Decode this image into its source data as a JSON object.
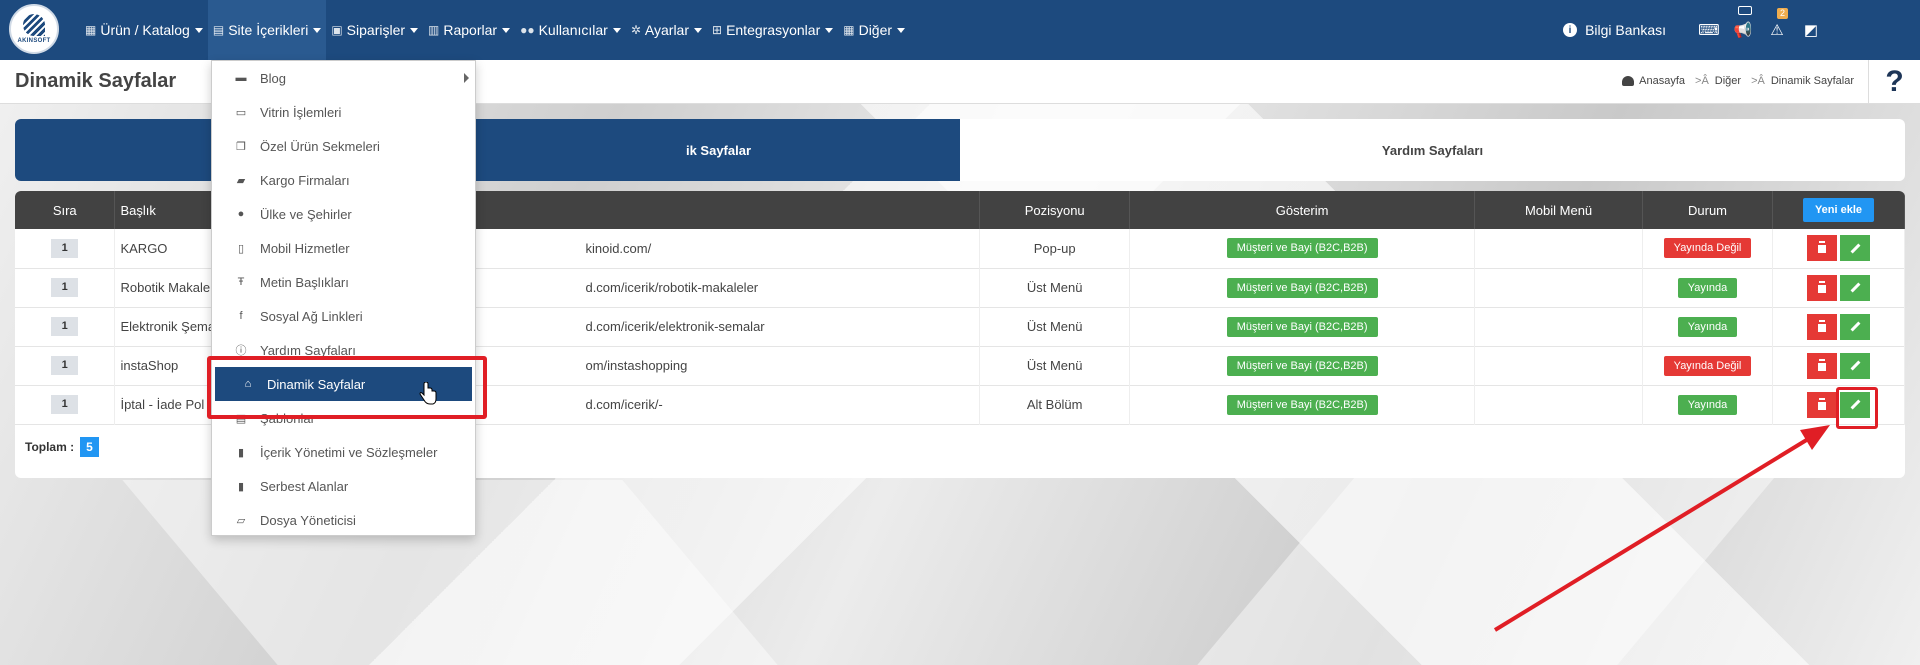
{
  "nav": {
    "logo_text": "AKINSOFT",
    "items": [
      {
        "label": "Ürün / Katalog",
        "icon": "cubes-icon"
      },
      {
        "label": "Site İçerikleri",
        "icon": "file-icon"
      },
      {
        "label": "Siparişler",
        "icon": "basket-icon"
      },
      {
        "label": "Raporlar",
        "icon": "report-icon"
      },
      {
        "label": "Kullanıcılar",
        "icon": "users-icon"
      },
      {
        "label": "Ayarlar",
        "icon": "gears-icon"
      },
      {
        "label": "Entegrasyonlar",
        "icon": "sitemap-icon"
      },
      {
        "label": "Diğer",
        "icon": "grid-icon"
      }
    ],
    "bilgi_label": "Bilgi Bankası",
    "alert_count": "2"
  },
  "header": {
    "title": "Dinamik Sayfalar",
    "breadcrumb": [
      "Anasayfa",
      "Diğer",
      "Dinamik Sayfalar"
    ],
    "sep": ">Â",
    "help": "?"
  },
  "tabs": [
    {
      "label": "Dinamik Sayfalar",
      "visible_label": "ik Sayfalar"
    },
    {
      "label": "Yardım Sayfaları"
    }
  ],
  "table": {
    "headers": {
      "sira": "Sıra",
      "baslik": "Başlık",
      "pozisyon": "Pozisyonu",
      "gosterim": "Gösterim",
      "mobil": "Mobil Menü",
      "durum": "Durum",
      "yeni": "Yeni ekle"
    },
    "rows": [
      {
        "sira": "1",
        "baslik": "KARGO",
        "url": "kinoid.com/",
        "pozisyon": "Pop-up",
        "gosterim": "Müşteri ve Bayi (B2C,B2B)",
        "durum": "Yayında Değil",
        "durum_status": "off"
      },
      {
        "sira": "1",
        "baslik": "Robotik Makale",
        "url": "d.com/icerik/robotik-makaleler",
        "pozisyon": "Üst Menü",
        "gosterim": "Müşteri ve Bayi (B2C,B2B)",
        "durum": "Yayında",
        "durum_status": "on"
      },
      {
        "sira": "1",
        "baslik": "Elektronik Şema",
        "url": "d.com/icerik/elektronik-semalar",
        "pozisyon": "Üst Menü",
        "gosterim": "Müşteri ve Bayi (B2C,B2B)",
        "durum": "Yayında",
        "durum_status": "on"
      },
      {
        "sira": "1",
        "baslik": "instaShop",
        "url": "om/instashopping",
        "pozisyon": "Üst Menü",
        "gosterim": "Müşteri ve Bayi (B2C,B2B)",
        "durum": "Yayında Değil",
        "durum_status": "off"
      },
      {
        "sira": "1",
        "baslik": "İptal - İade Pol",
        "url": "d.com/icerik/-",
        "pozisyon": "Alt Bölüm",
        "gosterim": "Müşteri ve Bayi (B2C,B2B)",
        "durum": "Yayında",
        "durum_status": "on"
      }
    ],
    "toplam_label": "Toplam :",
    "toplam_value": "5"
  },
  "dropdown": {
    "items": [
      {
        "label": "Blog",
        "icon": "list-icon",
        "submenu": true
      },
      {
        "label": "Vitrin İşlemleri",
        "icon": "monitor-icon"
      },
      {
        "label": "Özel Ürün Sekmeleri",
        "icon": "windows-icon"
      },
      {
        "label": "Kargo Firmaları",
        "icon": "truck-icon"
      },
      {
        "label": "Ülke ve Şehirler",
        "icon": "globe-icon"
      },
      {
        "label": "Mobil Hizmetler",
        "icon": "mobile-icon"
      },
      {
        "label": "Metin Başlıkları",
        "icon": "text-icon"
      },
      {
        "label": "Sosyal Ağ Linkleri",
        "icon": "facebook-icon"
      },
      {
        "label": "Yardım Sayfaları",
        "icon": "info-icon"
      },
      {
        "label": "Dinamik Sayfalar",
        "icon": "dynamic-icon",
        "active": true
      },
      {
        "label": "Şablonlar",
        "icon": "template-icon"
      },
      {
        "label": "İçerik Yönetimi ve Sözleşmeler",
        "icon": "contract-icon"
      },
      {
        "label": "Serbest Alanlar",
        "icon": "doc-icon"
      },
      {
        "label": "Dosya Yöneticisi",
        "icon": "folder-icon"
      }
    ]
  },
  "colors": {
    "navbar": "#1d4a7e",
    "accent_blue": "#2196f3",
    "green": "#4caf50",
    "red": "#e53935",
    "highlight": "#e01e25"
  }
}
